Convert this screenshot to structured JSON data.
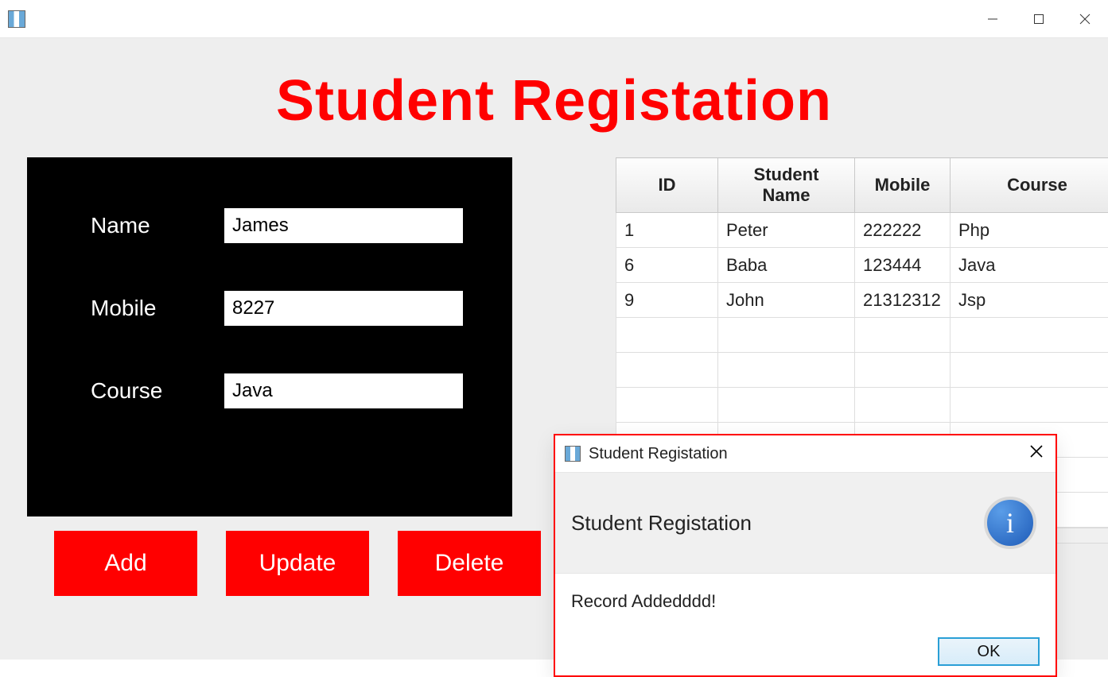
{
  "page": {
    "title": "Student Registation"
  },
  "form": {
    "labels": {
      "name": "Name",
      "mobile": "Mobile",
      "course": "Course"
    },
    "values": {
      "name": "James",
      "mobile": "8227",
      "course": "Java"
    }
  },
  "buttons": {
    "add": "Add",
    "update": "Update",
    "delete": "Delete"
  },
  "table": {
    "headers": {
      "id": "ID",
      "student_name": "Student Name",
      "mobile": "Mobile",
      "course": "Course"
    },
    "rows": [
      {
        "id": "1",
        "student_name": "Peter",
        "mobile": "222222",
        "course": "Php"
      },
      {
        "id": "6",
        "student_name": "Baba",
        "mobile": "123444",
        "course": "Java"
      },
      {
        "id": "9",
        "student_name": "John",
        "mobile": "21312312",
        "course": "Jsp"
      }
    ]
  },
  "dialog": {
    "window_title": "Student Registation",
    "header": "Student Registation",
    "message": "Record Addedddd!",
    "ok_label": "OK",
    "info_glyph": "i"
  }
}
